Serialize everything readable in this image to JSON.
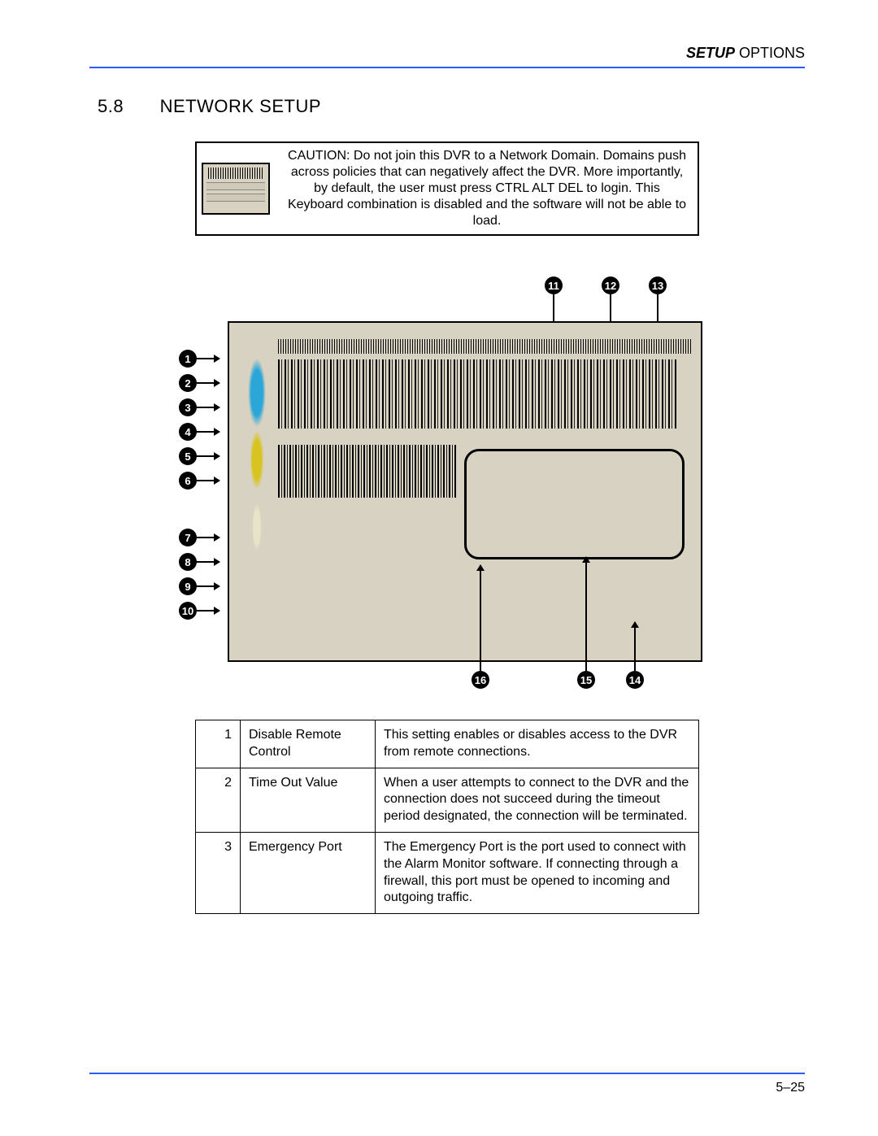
{
  "header": {
    "em": "SETUP",
    "rest": " OPTIONS"
  },
  "section": {
    "number": "5.8",
    "title": "NETWORK SETUP"
  },
  "caution": {
    "text": "CAUTION:  Do not join this DVR to a Network Domain. Domains push across policies that can negatively affect the DVR. More importantly, by default, the user must press CTRL ALT DEL to login. This Keyboard combination is disabled and the software will not be able to load."
  },
  "callouts_left": [
    "1",
    "2",
    "3",
    "4",
    "5",
    "6",
    "7",
    "8",
    "9",
    "10"
  ],
  "callouts_top": [
    "11",
    "12",
    "13"
  ],
  "callouts_bottom": [
    "16",
    "15",
    "14"
  ],
  "table": [
    {
      "num": "1",
      "name": "Disable Remote Control",
      "desc": "This setting enables or disables access to the DVR from remote connections."
    },
    {
      "num": "2",
      "name": "Time Out Value",
      "desc": "When a user attempts to connect to the DVR and the connection does not succeed during the timeout period designated, the connection will be terminated."
    },
    {
      "num": "3",
      "name": "Emergency Port",
      "desc": "The Emergency Port is the port used to connect with the Alarm Monitor software. If connecting through a firewall, this port must be opened to incoming and outgoing traffic."
    }
  ],
  "page_number": "5–25"
}
